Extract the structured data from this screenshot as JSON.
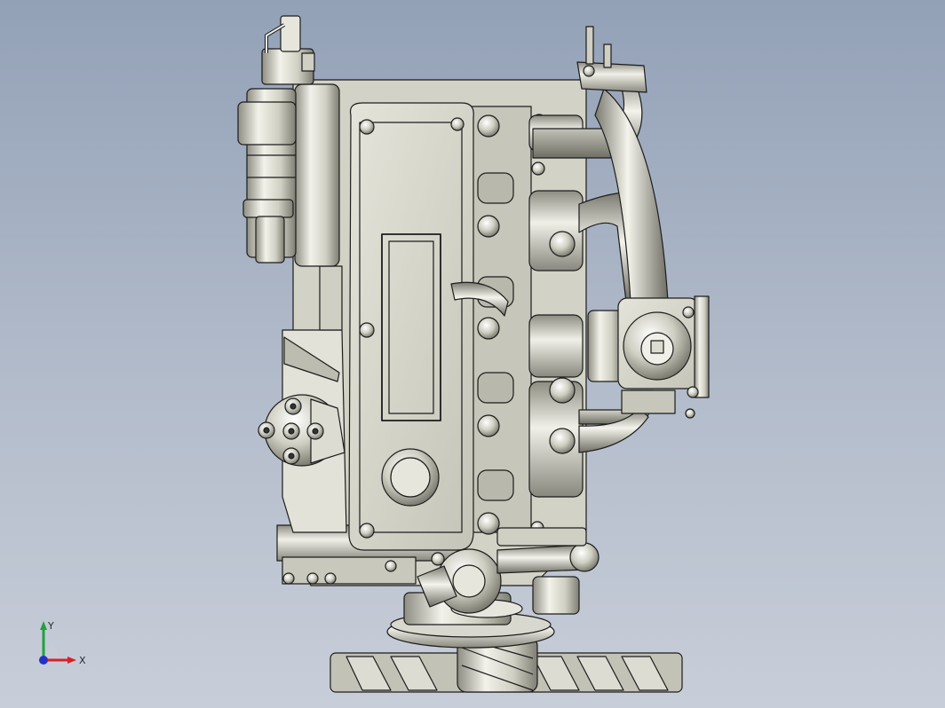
{
  "viewport": {
    "background_top": "#93a1b7",
    "background_bottom": "#c8ced9"
  },
  "model": {
    "metal_light": "#eeeee6",
    "metal_mid": "#c9c9bd",
    "metal_dark": "#8d8d82",
    "edge_color": "#1c1c1c"
  },
  "triad": {
    "x_label": "X",
    "y_label": "Y",
    "x_color": "#d8202a",
    "y_color": "#22a040",
    "z_color": "#2530c8"
  }
}
